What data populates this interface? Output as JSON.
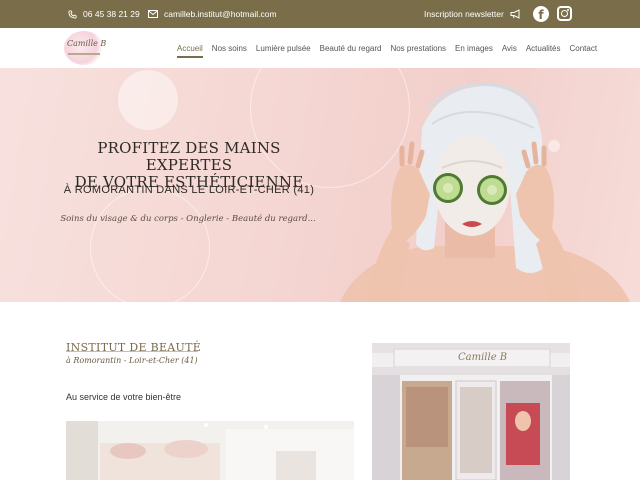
{
  "topbar": {
    "phone": "06 45 38 21 29",
    "email": "camilleb.institut@hotmail.com",
    "newsletter": "Inscription newsletter",
    "bg_color": "#7a6e4a"
  },
  "header": {
    "logo_text": "Camille B"
  },
  "nav": {
    "items": [
      "Accueil",
      "Nos soins",
      "Lumière pulsée",
      "Beauté du regard",
      "Nos prestations",
      "En images",
      "Avis",
      "Actualités",
      "Contact"
    ],
    "active": "Accueil"
  },
  "hero": {
    "title_line1": "PROFITEZ DES MAINS EXPERTES",
    "title_line2": "DE VOTRE ESTHÉTICIENNE",
    "subtitle": "À ROMORANTIN DANS LE LOIR-ET-CHER (41)",
    "tagline": "Soins du visage & du corps - Onglerie - Beauté du regard..."
  },
  "section": {
    "title": "INSTITUT DE BEAUTÉ",
    "subtitle": "à Romorantin - Loir-et-Cher (41)",
    "service_text": "Au service de votre bien-être",
    "shop_sign": "Camille B"
  },
  "icons": {
    "phone": "phone-icon",
    "mail": "mail-icon",
    "newsletter": "megaphone-icon",
    "facebook": "facebook-icon",
    "instagram": "instagram-icon"
  }
}
